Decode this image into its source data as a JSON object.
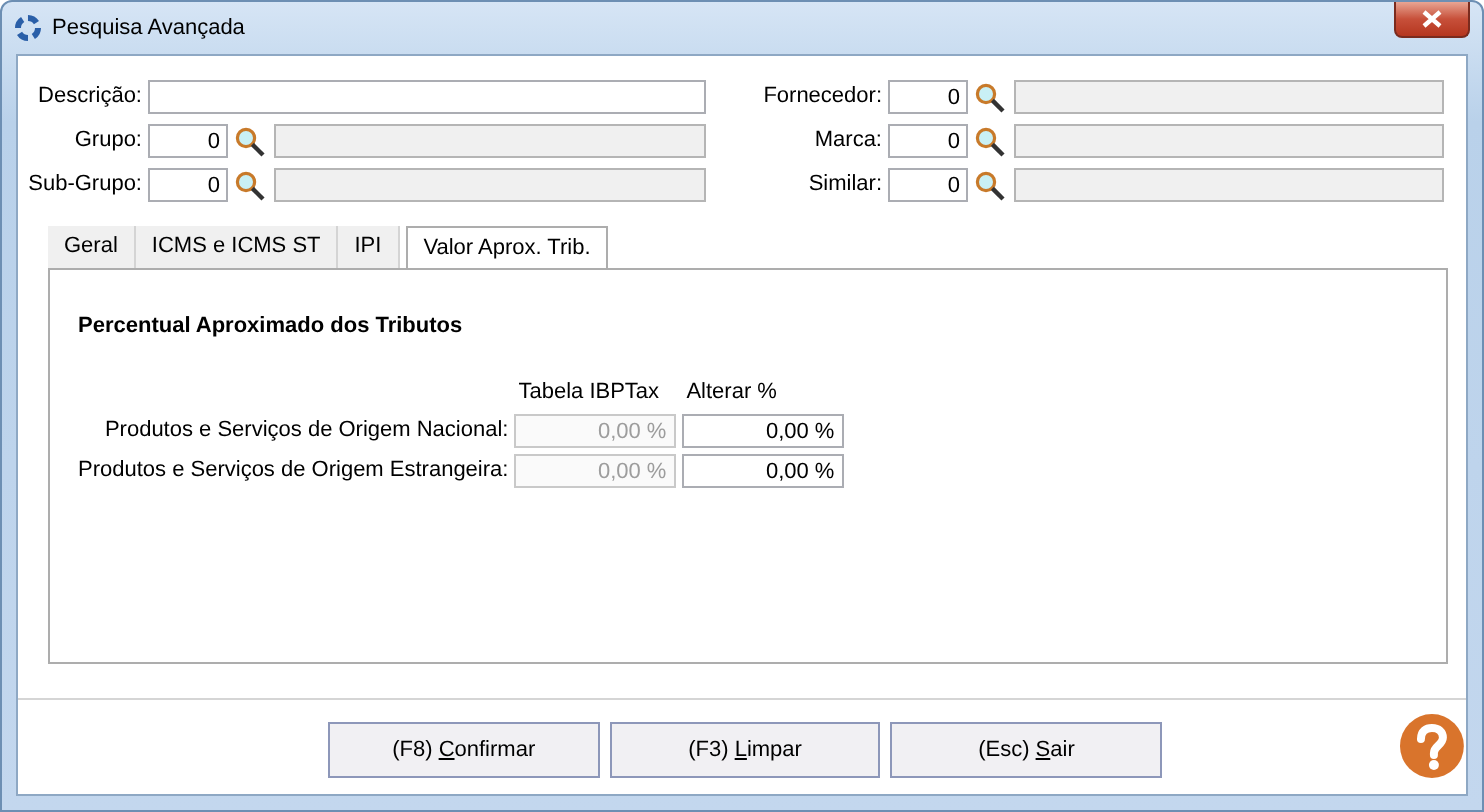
{
  "window": {
    "title": "Pesquisa Avançada"
  },
  "filters_left": [
    {
      "label": "Descrição:",
      "kind": "text"
    },
    {
      "label": "Grupo:",
      "kind": "lookup",
      "code": "0"
    },
    {
      "label": "Sub-Grupo:",
      "kind": "lookup",
      "code": "0"
    }
  ],
  "filters_right": [
    {
      "label": "Fornecedor:",
      "kind": "lookup",
      "code": "0"
    },
    {
      "label": "Marca:",
      "kind": "lookup",
      "code": "0"
    },
    {
      "label": "Similar:",
      "kind": "lookup",
      "code": "0"
    }
  ],
  "tabs": [
    {
      "label": "Geral",
      "selected": false
    },
    {
      "label": "ICMS e ICMS ST",
      "selected": false
    },
    {
      "label": "IPI",
      "selected": false
    },
    {
      "label": "Valor Aprox. Trib.",
      "selected": true
    }
  ],
  "panel": {
    "title": "Percentual Aproximado dos Tributos",
    "columns": [
      "Tabela IBPTax",
      "Alterar %"
    ],
    "rows": [
      {
        "label": "Produtos e Serviços de Origem Nacional:",
        "fields": [
          {
            "value": "0,00 %",
            "disabled": true
          },
          {
            "value": "0,00 %",
            "disabled": false
          }
        ]
      },
      {
        "label": "Produtos e Serviços de Origem Estrangeira:",
        "fields": [
          {
            "value": "0,00 %",
            "disabled": true
          },
          {
            "value": "0,00 %",
            "disabled": false
          }
        ]
      }
    ]
  },
  "buttons": [
    {
      "prefix": "(F8) ",
      "key": "C",
      "rest": "onfirmar"
    },
    {
      "prefix": "(F3) ",
      "key": "L",
      "rest": "impar"
    },
    {
      "prefix": "(Esc) ",
      "key": "S",
      "rest": "air"
    }
  ]
}
